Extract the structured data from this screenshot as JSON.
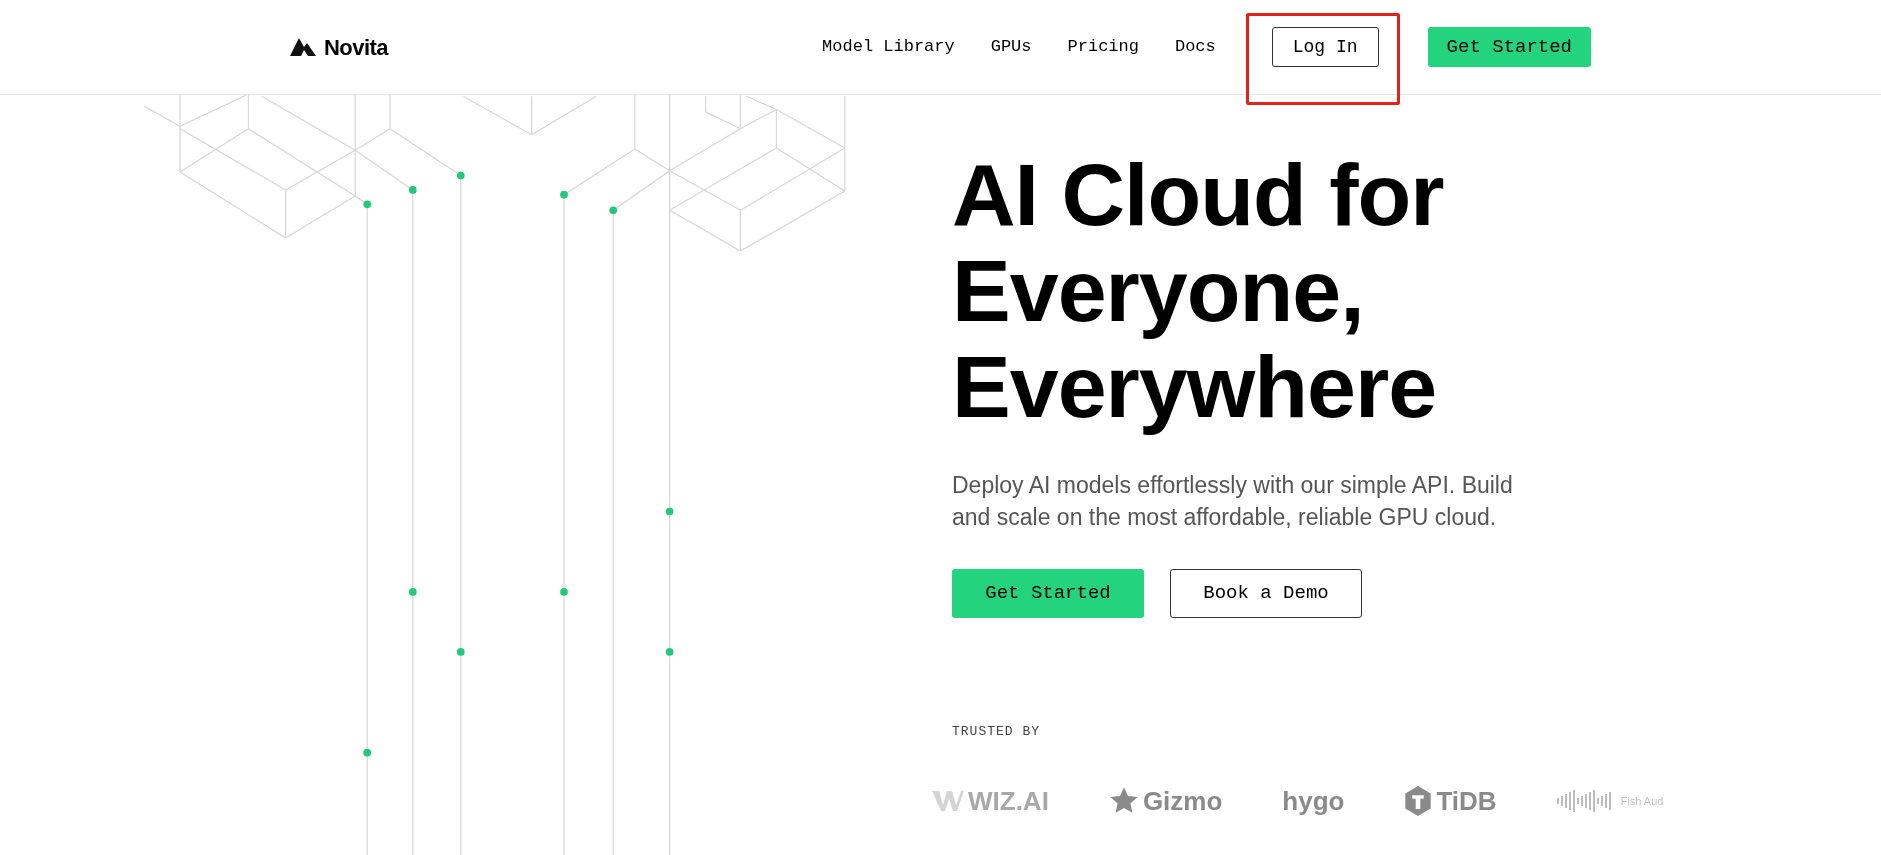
{
  "header": {
    "logo": "Novita",
    "nav": [
      {
        "label": "Model Library"
      },
      {
        "label": "GPUs"
      },
      {
        "label": "Pricing"
      },
      {
        "label": "Docs"
      }
    ],
    "login": {
      "label": "Log In",
      "highlighted": true
    },
    "cta": "Get Started"
  },
  "hero": {
    "title_lines": [
      "AI Cloud for",
      "Everyone,",
      "Everywhere"
    ],
    "subtitle": "Deploy AI models effortlessly with our simple API. Build and scale on the most affordable, reliable GPU cloud.",
    "buttons": [
      {
        "label": "Get Started",
        "kind": "primary"
      },
      {
        "label": "Book a Demo",
        "kind": "outline"
      }
    ]
  },
  "trusted": {
    "label": "TRUSTED BY",
    "logos": [
      {
        "name": "WIZ.AI"
      },
      {
        "name": "Gizmo"
      },
      {
        "name": "hygo"
      },
      {
        "name": "TiDB"
      },
      {
        "name": "Fish Aud"
      }
    ]
  }
}
